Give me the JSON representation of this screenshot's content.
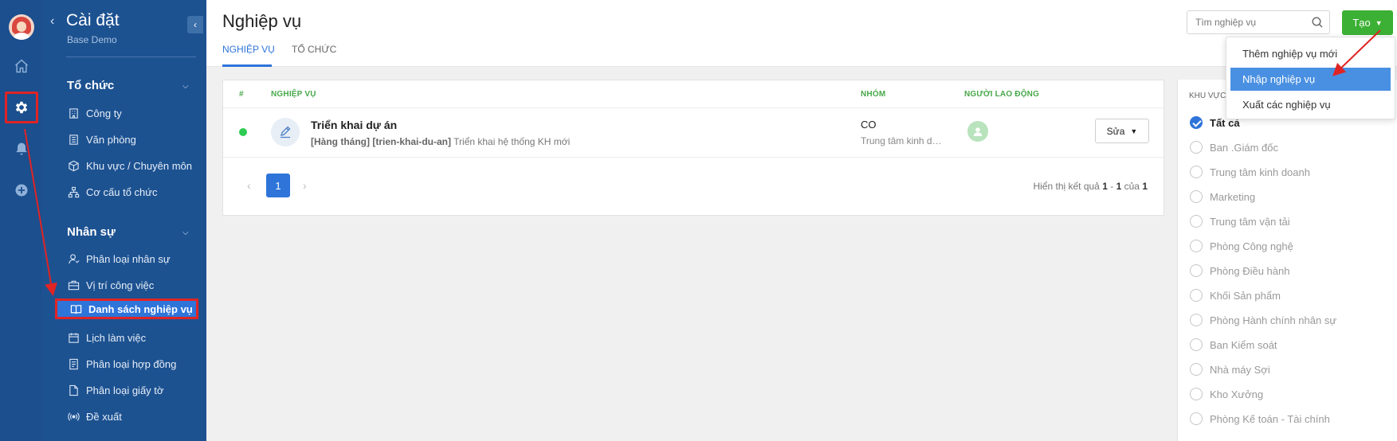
{
  "sidebar": {
    "title": "Cài đặt",
    "subtitle": "Base Demo",
    "sections": [
      {
        "label": "Tổ chức"
      },
      {
        "label": "Nhân sự"
      }
    ],
    "items": [
      {
        "label": "Công ty"
      },
      {
        "label": "Văn phòng"
      },
      {
        "label": "Khu vực / Chuyên môn"
      },
      {
        "label": "Cơ cấu tổ chức"
      },
      {
        "label": "Phân loại nhân sự"
      },
      {
        "label": "Vị trí công việc"
      },
      {
        "label": "Danh sách nghiệp vụ"
      },
      {
        "label": "Lịch làm việc"
      },
      {
        "label": "Phân loại hợp đồng"
      },
      {
        "label": "Phân loại giấy tờ"
      },
      {
        "label": "Đề xuất"
      }
    ]
  },
  "header": {
    "title": "Nghiệp vụ",
    "tabs": [
      {
        "label": "NGHIỆP VỤ"
      },
      {
        "label": "TỔ CHỨC"
      }
    ],
    "search_placeholder": "Tìm nghiệp vụ",
    "create_label": "Tạo"
  },
  "dropdown": {
    "items": [
      {
        "label": "Thêm nghiệp vụ mới"
      },
      {
        "label": "Nhập nghiệp vụ"
      },
      {
        "label": "Xuất các nghiệp vụ"
      }
    ]
  },
  "table": {
    "columns": [
      "#",
      "NGHIỆP VỤ",
      "NHÓM",
      "NGƯỜI LAO ĐỘNG"
    ],
    "rows": [
      {
        "name": "Triển khai dự án",
        "tag_freq": "[Hàng tháng]",
        "tag_code": "[trien-khai-du-an]",
        "description": "Triển khai hệ thống KH mới",
        "group": "CO",
        "group_sub": "Trung tâm kinh doanh",
        "edit_label": "Sửa"
      }
    ]
  },
  "pagination": {
    "page": "1",
    "info_prefix": "Hiển thị kết quả",
    "from": "1",
    "sep": "-",
    "to": "1",
    "of_label": "của",
    "total": "1"
  },
  "filter": {
    "heading": "KHU VỰC",
    "options": [
      {
        "label": "Tất cả"
      },
      {
        "label": "Ban .Giám đốc"
      },
      {
        "label": "Trung tâm kinh doanh"
      },
      {
        "label": "Marketing"
      },
      {
        "label": "Trung tâm vận tải"
      },
      {
        "label": "Phòng Công nghệ"
      },
      {
        "label": "Phòng Điều hành"
      },
      {
        "label": "Khối Sản phẩm"
      },
      {
        "label": "Phòng Hành chính nhân sự"
      },
      {
        "label": "Ban Kiểm soát"
      },
      {
        "label": "Nhà máy Sợi"
      },
      {
        "label": "Kho Xưởng"
      },
      {
        "label": "Phòng Kế toán - Tài chính"
      }
    ]
  },
  "colors": {
    "rail": "#1b4f8e",
    "sidebar": "#1d5291",
    "accent": "#2e74d9",
    "create": "#3cb034",
    "annotation": "#e02424"
  }
}
